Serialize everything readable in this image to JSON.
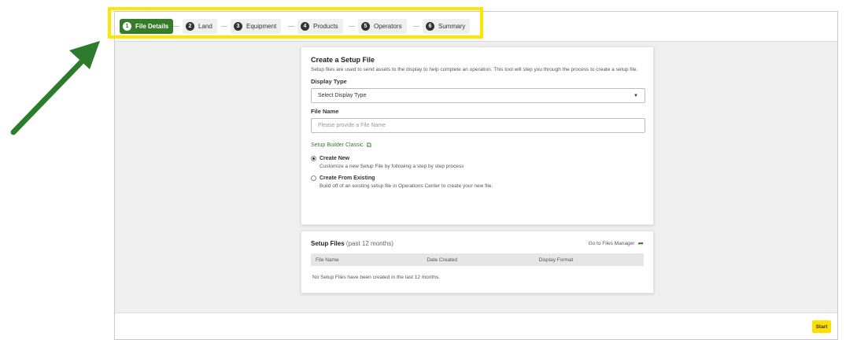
{
  "steps": [
    {
      "num": "1",
      "label": "File Details",
      "active": true
    },
    {
      "num": "2",
      "label": "Land"
    },
    {
      "num": "3",
      "label": "Equipment"
    },
    {
      "num": "4",
      "label": "Products"
    },
    {
      "num": "5",
      "label": "Operators"
    },
    {
      "num": "6",
      "label": "Summary"
    }
  ],
  "create": {
    "title": "Create a Setup File",
    "description": "Setup files are used to send assets to the display to help complete an operation. This tool will step you through the process to create a setup file.",
    "display_type_label": "Display Type",
    "display_type_value": "Select Display Type",
    "file_name_label": "File Name",
    "file_name_placeholder": "Please provide a File Name",
    "classic_link": "Setup Builder Classic",
    "options": [
      {
        "title": "Create New",
        "description": "Customize a new Setup File by following a step by step process",
        "checked": true
      },
      {
        "title": "Create From Existing",
        "description": "Build off of an existing setup file in Operations Center to create your new file.",
        "checked": false
      }
    ]
  },
  "files": {
    "title": "Setup Files",
    "subtitle": "(past 12 months)",
    "manager_link": "Go to Files Manager",
    "columns": [
      "File Name",
      "Date Created",
      "Display Format"
    ],
    "empty_message": "No Setup Files have been created in the last 12 months."
  },
  "footer": {
    "start_label": "Start"
  },
  "colors": {
    "brand_green": "#367c2b",
    "highlight_yellow": "#ffe600",
    "start_yellow": "#ffde00"
  },
  "icons": {
    "external": "external-link-icon",
    "share": "share-arrow-icon",
    "caret": "caret-down-icon"
  }
}
